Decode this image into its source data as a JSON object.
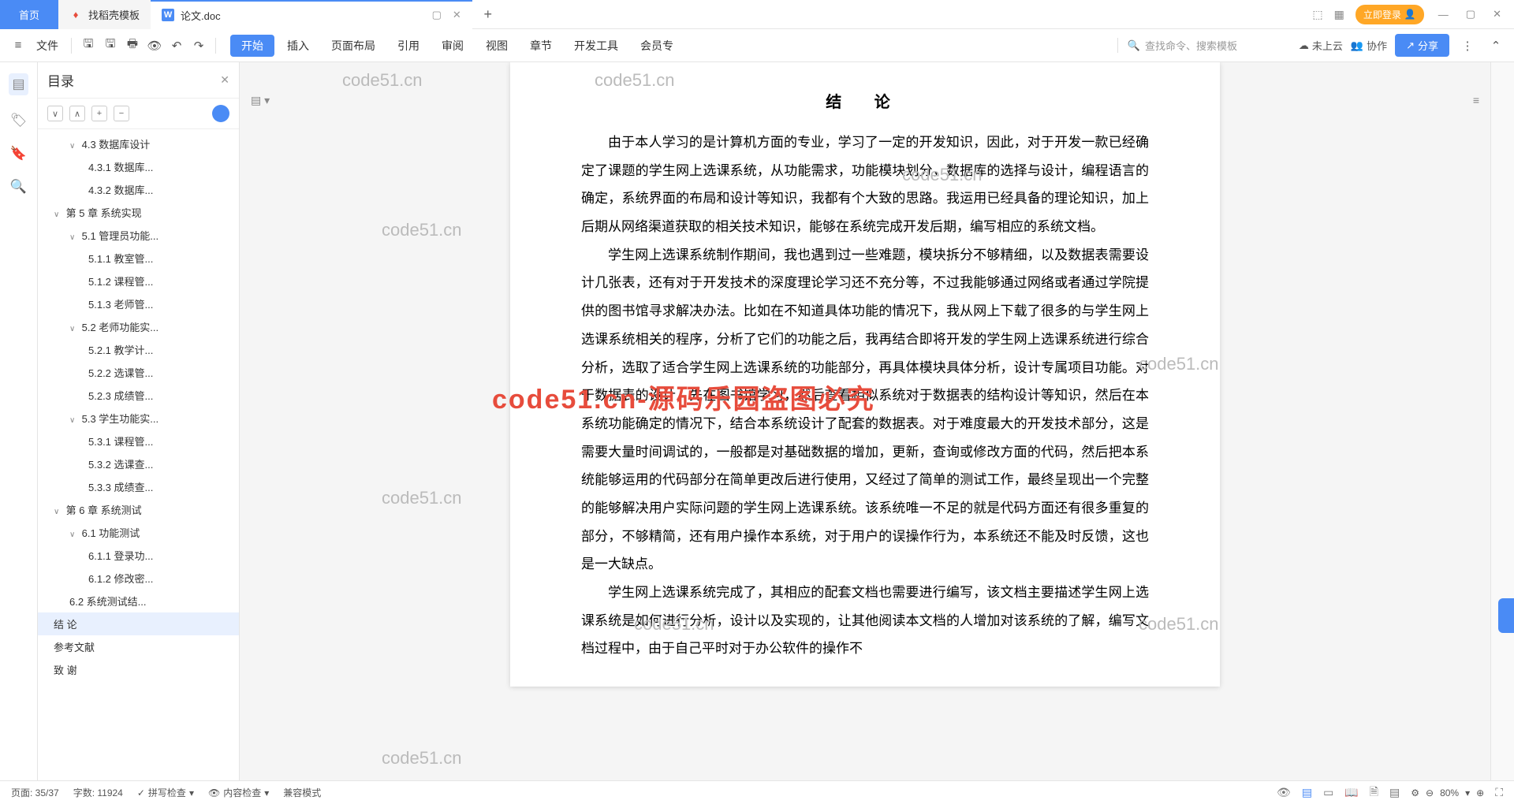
{
  "tabs": {
    "home": "首页",
    "template": "找稻壳模板",
    "doc": "论文.doc"
  },
  "topright": {
    "login": "立即登录"
  },
  "ribbon": {
    "file": "文件",
    "menu": [
      "开始",
      "插入",
      "页面布局",
      "引用",
      "审阅",
      "视图",
      "章节",
      "开发工具",
      "会员专"
    ],
    "search_placeholder": "查找命令、搜索模板",
    "cloud": "未上云",
    "collab": "协作",
    "share": "分享"
  },
  "outline": {
    "title": "目录",
    "items": [
      {
        "lvl": 2,
        "txt": "4.3 数据库设计",
        "arrow": "∨"
      },
      {
        "lvl": 3,
        "txt": "4.3.1 数据库..."
      },
      {
        "lvl": 3,
        "txt": "4.3.2 数据库..."
      },
      {
        "lvl": 1,
        "txt": "第 5 章  系统实现",
        "arrow": "∨"
      },
      {
        "lvl": 2,
        "txt": "5.1 管理员功能...",
        "arrow": "∨"
      },
      {
        "lvl": 3,
        "txt": "5.1.1 教室管..."
      },
      {
        "lvl": 3,
        "txt": "5.1.2 课程管..."
      },
      {
        "lvl": 3,
        "txt": "5.1.3 老师管..."
      },
      {
        "lvl": 2,
        "txt": "5.2 老师功能实...",
        "arrow": "∨"
      },
      {
        "lvl": 3,
        "txt": "5.2.1 教学计..."
      },
      {
        "lvl": 3,
        "txt": "5.2.2 选课管..."
      },
      {
        "lvl": 3,
        "txt": "5.2.3 成绩管..."
      },
      {
        "lvl": 2,
        "txt": "5.3 学生功能实...",
        "arrow": "∨"
      },
      {
        "lvl": 3,
        "txt": "5.3.1 课程管..."
      },
      {
        "lvl": 3,
        "txt": "5.3.2 选课查..."
      },
      {
        "lvl": 3,
        "txt": "5.3.3 成绩查..."
      },
      {
        "lvl": 1,
        "txt": "第 6 章  系统测试",
        "arrow": "∨"
      },
      {
        "lvl": 2,
        "txt": "6.1 功能测试",
        "arrow": "∨"
      },
      {
        "lvl": 3,
        "txt": "6.1.1 登录功..."
      },
      {
        "lvl": 3,
        "txt": "6.1.2 修改密..."
      },
      {
        "lvl": 2,
        "txt": "6.2 系统测试结..."
      },
      {
        "lvl": 1,
        "txt": "结   论",
        "sel": true
      },
      {
        "lvl": 1,
        "txt": "参考文献"
      },
      {
        "lvl": 1,
        "txt": "致   谢"
      }
    ]
  },
  "doc": {
    "h": "结  论",
    "p1": "由于本人学习的是计算机方面的专业，学习了一定的开发知识，因此，对于开发一款已经确定了课题的学生网上选课系统，从功能需求，功能模块划分，数据库的选择与设计，编程语言的确定，系统界面的布局和设计等知识，我都有个大致的思路。我运用已经具备的理论知识，加上后期从网络渠道获取的相关技术知识，能够在系统完成开发后期，编写相应的系统文档。",
    "p2": "学生网上选课系统制作期间，我也遇到过一些难题，模块拆分不够精细，以及数据表需要设计几张表，还有对于开发技术的深度理论学习还不充分等，不过我能够通过网络或者通过学院提供的图书馆寻求解决办法。比如在不知道具体功能的情况下，我从网上下载了很多的与学生网上选课系统相关的程序，分析了它们的功能之后，我再结合即将开发的学生网上选课系统进行综合分析，选取了适合学生网上选课系统的功能部分，再具体模块具体分析，设计专属项目功能。对于数据表的设计，先在图书馆学习，然后查看相似系统对于数据表的结构设计等知识，然后在本系统功能确定的情况下，结合本系统设计了配套的数据表。对于难度最大的开发技术部分，这是需要大量时间调试的，一般都是对基础数据的增加，更新，查询或修改方面的代码，然后把本系统能够运用的代码部分在简单更改后进行使用，又经过了简单的测试工作，最终呈现出一个完整的能够解决用户实际问题的学生网上选课系统。该系统唯一不足的就是代码方面还有很多重复的部分，不够精简，还有用户操作本系统，对于用户的误操作行为，本系统还不能及时反馈，这也是一大缺点。",
    "p3": "学生网上选课系统完成了，其相应的配套文档也需要进行编写，该文档主要描述学生网上选课系统是如何进行分析，设计以及实现的，让其他阅读本文档的人增加对该系统的了解，编写文档过程中，由于自己平时对于办公软件的操作不"
  },
  "watermarks": {
    "t": "code51.cn",
    "red": "code51.cn-源码乐园盗图必究"
  },
  "status": {
    "page": "页面: 35/37",
    "words": "字数: 11924",
    "spell": "拼写检查",
    "content": "内容检查",
    "compat": "兼容模式",
    "zoom": "80%"
  }
}
